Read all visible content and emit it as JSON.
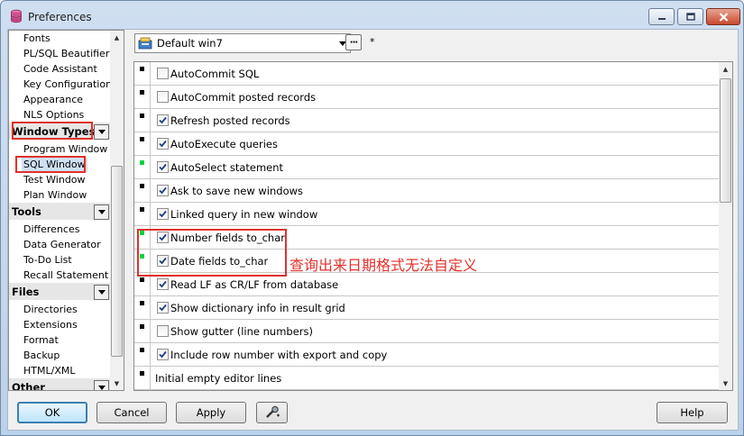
{
  "window": {
    "title": "Preferences",
    "app_icon": "database-icon"
  },
  "nav": {
    "items_top": [
      "Fonts",
      "PL/SQL Beautifier",
      "Code Assistant",
      "Key Configuration",
      "Appearance",
      "NLS Options"
    ],
    "groups": [
      {
        "label": "Window Types",
        "items": [
          "Program Window",
          "SQL Window",
          "Test Window",
          "Plan Window"
        ],
        "selected": "SQL Window"
      },
      {
        "label": "Tools",
        "items": [
          "Differences",
          "Data Generator",
          "To-Do List",
          "Recall Statement"
        ]
      },
      {
        "label": "Files",
        "items": [
          "Directories",
          "Extensions",
          "Format",
          "Backup",
          "HTML/XML"
        ]
      },
      {
        "label": "Other",
        "items": []
      }
    ]
  },
  "profile": {
    "value": "Default win7",
    "modified_mark": "*"
  },
  "options": [
    {
      "label": "AutoCommit SQL",
      "checked": false,
      "marker": "black"
    },
    {
      "label": "AutoCommit posted records",
      "checked": false,
      "marker": "black"
    },
    {
      "label": "Refresh posted records",
      "checked": true,
      "marker": "black"
    },
    {
      "label": "AutoExecute queries",
      "checked": true,
      "marker": "black"
    },
    {
      "label": "AutoSelect statement",
      "checked": true,
      "marker": "green"
    },
    {
      "label": "Ask to save new windows",
      "checked": true,
      "marker": "black"
    },
    {
      "label": "Linked query in new window",
      "checked": true,
      "marker": "black"
    },
    {
      "label": "Number fields to_char",
      "checked": true,
      "marker": "green"
    },
    {
      "label": "Date fields to_char",
      "checked": true,
      "marker": "green"
    },
    {
      "label": "Read LF as CR/LF from database",
      "checked": true,
      "marker": "black"
    },
    {
      "label": "Show dictionary info in result grid",
      "checked": true,
      "marker": "black"
    },
    {
      "label": "Show gutter (line numbers)",
      "checked": false,
      "marker": "black"
    },
    {
      "label": "Include row number with export and copy",
      "checked": true,
      "marker": "black"
    },
    {
      "label": "Initial empty editor lines",
      "checked": null,
      "marker": "black"
    }
  ],
  "annotation": "查询出来日期格式无法自定义",
  "buttons": {
    "ok": "OK",
    "cancel": "Cancel",
    "apply": "Apply",
    "help": "Help"
  },
  "colors": {
    "highlight": "#e0312c",
    "selection": "#cfe0f5",
    "marker_green": "#00d23c"
  }
}
